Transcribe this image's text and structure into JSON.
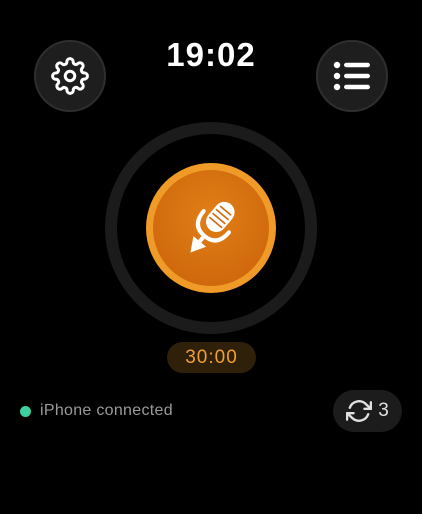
{
  "header": {
    "time": "19:02"
  },
  "icons": {
    "settings": "gear-icon",
    "menu": "list-icon",
    "record": "microphone-icon",
    "sync": "sync-icon"
  },
  "recorder": {
    "timer": "30:00"
  },
  "status": {
    "text": "iPhone connected",
    "dot_color": "#3fd0a0"
  },
  "sync": {
    "count": "3"
  },
  "colors": {
    "accent": "#f09a28",
    "accent_dark": "#d06a0d",
    "timer_text": "#f0a030",
    "background": "#000000"
  }
}
